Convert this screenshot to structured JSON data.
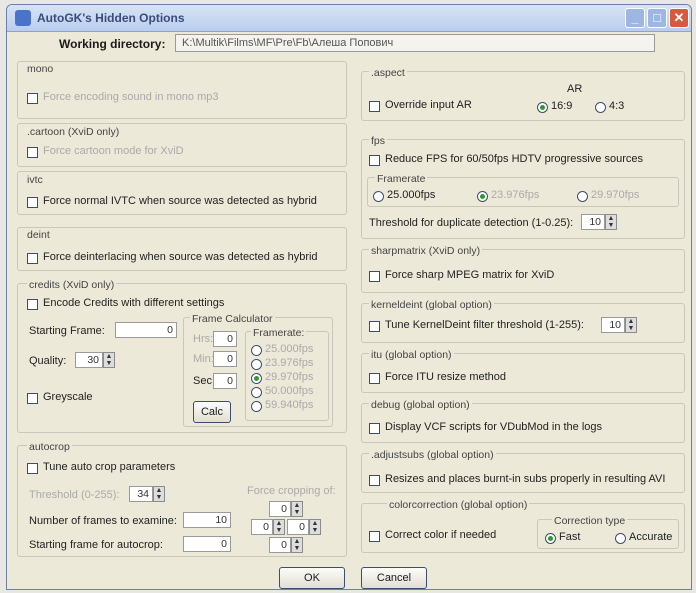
{
  "window": {
    "title": "AutoGK's Hidden Options"
  },
  "working_directory": {
    "label": "Working directory:",
    "value": "K:\\Multik\\Films\\MF\\Pre\\Fb\\Алеша Попович"
  },
  "mono": {
    "title": "mono",
    "checkbox": "Force encoding sound in mono mp3"
  },
  "cartoon": {
    "title": ".cartoon (XviD only)",
    "checkbox": "Force cartoon mode for XviD"
  },
  "ivtc": {
    "title": "ivtc",
    "checkbox": "Force normal IVTC when source was detected as hybrid"
  },
  "deint": {
    "title": "deint",
    "checkbox": "Force deinterlacing when source was detected as hybrid"
  },
  "credits": {
    "title": "credits (XviD only)",
    "checkbox": "Encode Credits with different settings",
    "starting_frame_label": "Starting Frame:",
    "starting_frame_value": "0",
    "quality_label": "Quality:",
    "quality_value": "30",
    "greyscale": "Greyscale",
    "calc": {
      "title": "Frame Calculator",
      "hrs": "Hrs:",
      "hrs_value": "0",
      "min": "Min:",
      "min_value": "0",
      "sec": "Sec:",
      "sec_value": "0",
      "calc_button": "Calc",
      "framerate_title": "Framerate:",
      "framerates": [
        "25.000fps",
        "23.976fps",
        "29.970fps",
        "50.000fps",
        "59.940fps"
      ],
      "selected_index": 2
    }
  },
  "autocrop": {
    "title": "autocrop",
    "checkbox": "Tune auto crop parameters",
    "threshold_label": "Threshold (0-255):",
    "threshold_value": "34",
    "frames_label": "Number of frames to examine:",
    "frames_value": "10",
    "start_label": "Starting frame for autocrop:",
    "start_value": "0",
    "forced_label": "Force cropping of:",
    "crop_top": "0",
    "crop_left": "0",
    "crop_right": "0",
    "crop_bottom": "0"
  },
  "aspect": {
    "title": ".aspect",
    "checkbox": "Override input AR",
    "ar_label": "AR",
    "ar_options": [
      "16:9",
      "4:3"
    ],
    "selected_index": 0
  },
  "fps": {
    "title": "fps",
    "checkbox": "Reduce FPS for 60/50fps HDTV progressive sources",
    "framerate_title": "Framerate",
    "options": [
      "25.000fps",
      "23.976fps",
      "29.970fps"
    ],
    "selected_index": 1,
    "threshold_label": "Threshold for duplicate detection (1-0.25):",
    "threshold_value": "10"
  },
  "sharpmatrix": {
    "title": "sharpmatrix (XviD only)",
    "checkbox": "Force sharp MPEG matrix for XviD"
  },
  "kerneldeint": {
    "title": "kerneldeint (global option)",
    "checkbox": "Tune KernelDeint filter threshold (1-255):",
    "value": "10"
  },
  "itu": {
    "title": "itu (global option)",
    "checkbox": "Force ITU resize method"
  },
  "debug": {
    "title": "debug (global option)",
    "checkbox": "Display VCF scripts for VDubMod in the logs"
  },
  "adjustsubs": {
    "title": ".adjustsubs (global option)",
    "checkbox": "Resizes and places burnt-in subs properly in resulting AVI"
  },
  "colorcorrection": {
    "title": "colorcorrection (global option)",
    "checkbox": "Correct color if needed",
    "type_title": "Correction type",
    "options": [
      "Fast",
      "Accurate"
    ],
    "selected_index": 0
  },
  "buttons": {
    "ok": "OK",
    "cancel": "Cancel"
  }
}
